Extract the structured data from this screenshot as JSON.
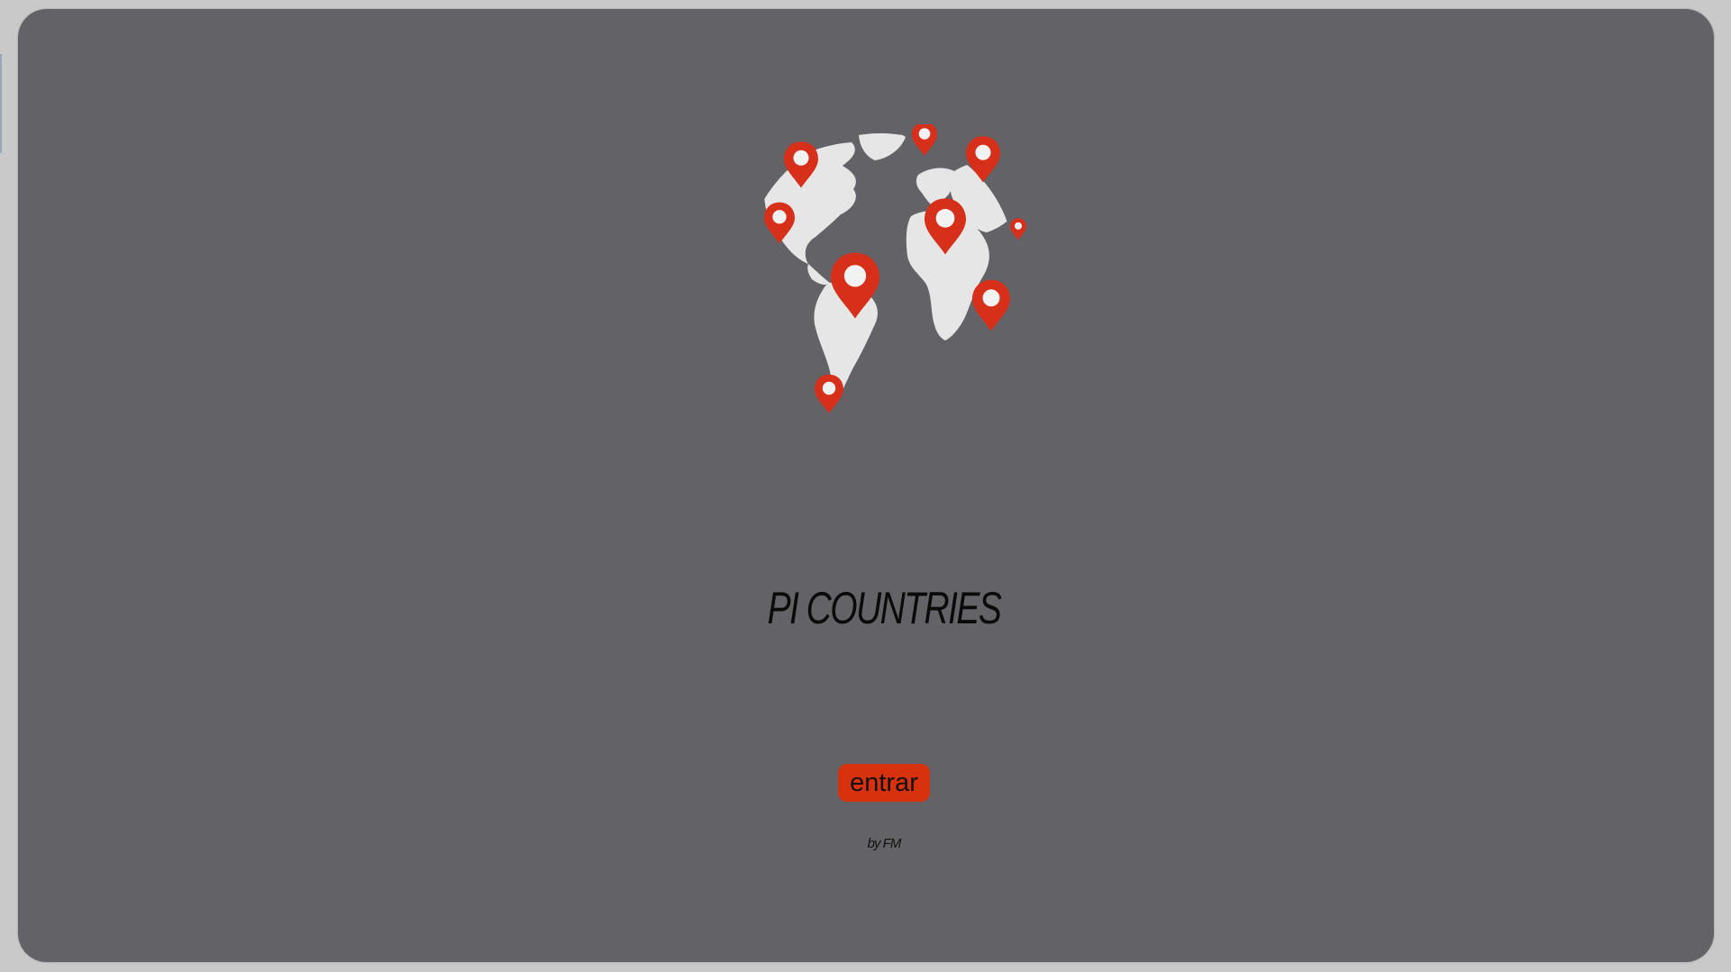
{
  "landing": {
    "title": "PI COUNTRIES",
    "enter_label": "entrar",
    "credit": "by FM"
  },
  "logo": {
    "icon": "world-map-pins-icon"
  },
  "colors": {
    "panel_background": "#636267",
    "frame_background": "#c9c9c9",
    "continents": "#e6e6e6",
    "pins": "#d62f1a",
    "button": "#d7310e",
    "text": "#0a0a0a"
  }
}
